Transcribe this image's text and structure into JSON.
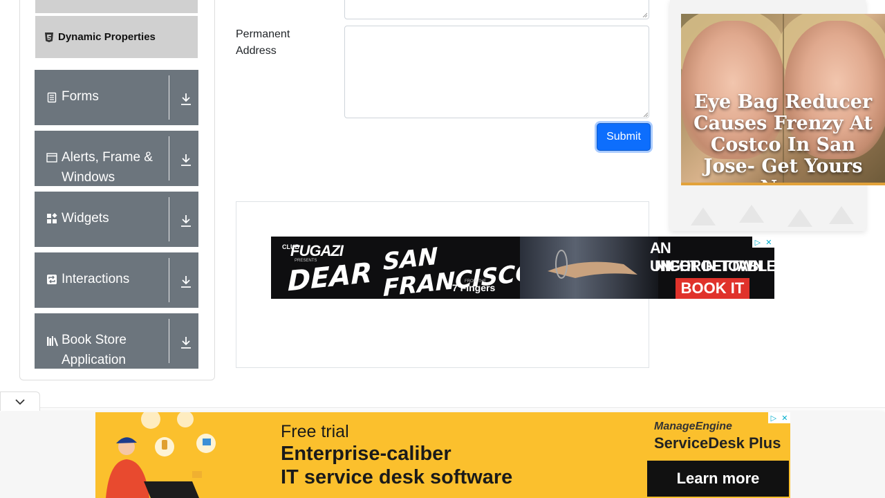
{
  "sidebar": {
    "sub_item_label": "Dynamic Properties",
    "groups": [
      {
        "label": "Forms",
        "icon": "form-icon"
      },
      {
        "label": "Alerts, Frame & Windows",
        "icon": "window-icon"
      },
      {
        "label": "Widgets",
        "icon": "widgets-icon"
      },
      {
        "label": "Interactions",
        "icon": "interactions-icon"
      },
      {
        "label": "Book Store Application",
        "icon": "books-icon"
      }
    ]
  },
  "form": {
    "permanent_address_label": "Permanent Address",
    "permanent_address_value": "",
    "submit_label": "Submit"
  },
  "ads": {
    "right": {
      "headline": "Eye Bag Reducer Causes Frenzy At Costco In San Jose- Get Yours Now"
    },
    "middle": {
      "brand": "FUGAZI",
      "brand_prefix": "CLUB",
      "brand_sub": "PRESENTS",
      "line_a": "DEAR",
      "line_b": "SAN FRANCISCO",
      "from_label": "FROM THE",
      "seven_fingers": "7 Fingers",
      "tagline_1": "AN UNFORGETTABLE",
      "tagline_2": "NIGHT IN TOWN",
      "cta": "BOOK IT"
    },
    "bottom": {
      "line1": "Free trial",
      "line2": "Enterprise-caliber",
      "line3": "IT service desk software",
      "brand1": "ManageEngine",
      "brand2": "ServiceDesk Plus",
      "cta": "Learn more"
    }
  },
  "colors": {
    "sidebar_group_bg": "#6c757d",
    "sidebar_sub_bg": "#d0d0d0",
    "submit_bg": "#0d6efd",
    "bottom_ad_bg": "#fbc02d",
    "book_it_bg": "#e0322b"
  }
}
